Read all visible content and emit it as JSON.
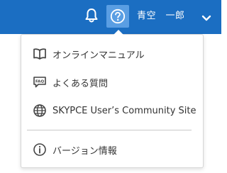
{
  "header": {
    "user_name": "青空　一郎",
    "bell_icon": "bell-icon",
    "help_icon": "question-circle-icon",
    "chevron_icon": "chevron-down-icon",
    "colors": {
      "bar": "#1b6ec2",
      "help_highlight": "#5a9ee3"
    }
  },
  "help_menu": {
    "items": [
      {
        "label": "オンラインマニュアル",
        "icon": "book-open-icon"
      },
      {
        "label": "よくある質問",
        "icon": "faq-bubble-icon"
      },
      {
        "label": "SKYPCE User’s Community Site",
        "icon": "globe-icon"
      },
      {
        "label": "バージョン情報",
        "icon": "info-circle-icon"
      }
    ]
  }
}
